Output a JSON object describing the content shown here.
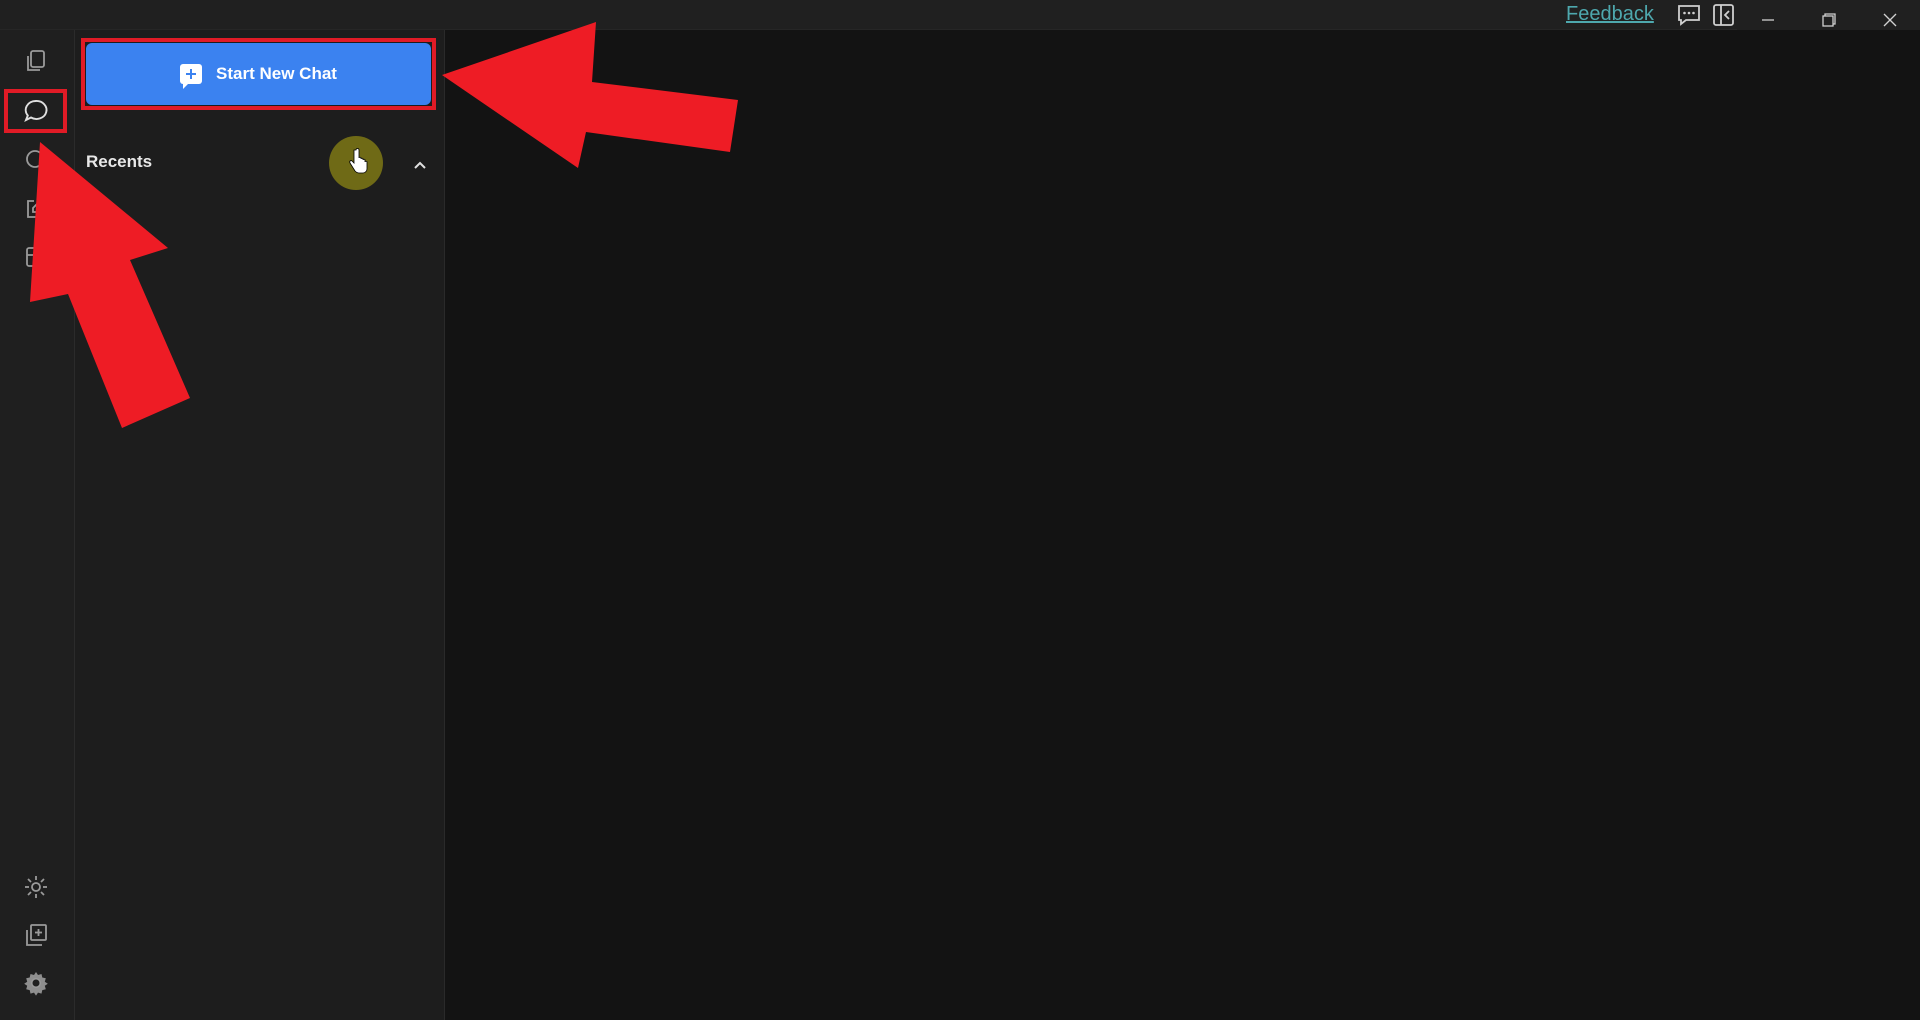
{
  "titlebar": {
    "feedback_label": "Feedback",
    "icons": [
      "chat-feedback-icon",
      "toggle-panel-icon"
    ],
    "window_controls": [
      "minimize-icon",
      "restore-icon",
      "close-icon"
    ]
  },
  "rail": {
    "items": [
      {
        "name": "documents-icon"
      },
      {
        "name": "chat-icon",
        "active": true
      },
      {
        "name": "search-icon"
      },
      {
        "name": "edit-icon"
      },
      {
        "name": "archive-icon"
      }
    ],
    "bottom_items": [
      {
        "name": "theme-icon"
      },
      {
        "name": "add-document-icon"
      },
      {
        "name": "settings-icon"
      }
    ]
  },
  "sidebar": {
    "new_chat_label": "Start New Chat",
    "recents_title": "Recents"
  },
  "colors": {
    "accent": "#3b82f0",
    "annotation": "#e01b26",
    "feedback_link": "#4ea8ae"
  }
}
